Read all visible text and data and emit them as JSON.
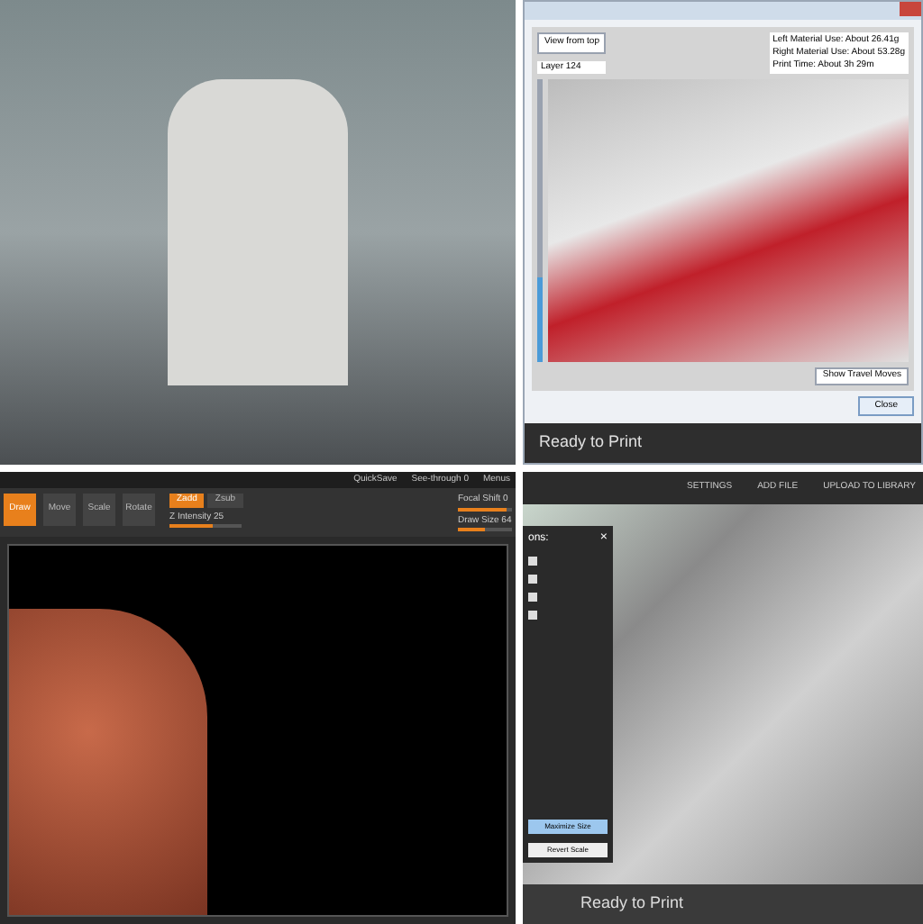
{
  "printer_preview": {
    "view_button": "View from top",
    "layer_label": "Layer 124",
    "layer_slider": {
      "level": 0.3
    },
    "info_lines": [
      "Left Material Use: About 26.41g",
      "Right Material Use: About 53.28g",
      "Print Time: About 3h 29m"
    ],
    "travel_button": "Show Travel Moves",
    "close_button": "Close",
    "status": "Ready to Print"
  },
  "sculpt_app": {
    "title_items": [
      "QuickSave",
      "See-through 0",
      "Menus"
    ],
    "tools": [
      {
        "label": "Draw",
        "selected": true
      },
      {
        "label": "Move",
        "selected": false
      },
      {
        "label": "Scale",
        "selected": false
      },
      {
        "label": "Rotate",
        "selected": false
      }
    ],
    "modes": [
      {
        "label": "Zadd",
        "selected": true
      },
      {
        "label": "Zsub",
        "selected": false
      }
    ],
    "settings": [
      {
        "label": "Focal Shift 0",
        "level": 0.9
      },
      {
        "label": "Draw Size 64",
        "level": 0.5
      }
    ],
    "intensity": {
      "label": "Z Intensity 25",
      "level": 0.6
    }
  },
  "print_app": {
    "nav": [
      "SETTINGS",
      "ADD FILE",
      "UPLOAD TO LIBRARY"
    ],
    "panel_title": "ons:",
    "panel_close": "×",
    "panel_options": [
      {
        "checked": false
      },
      {
        "checked": false
      },
      {
        "checked": false
      },
      {
        "checked": false
      }
    ],
    "buttons": [
      {
        "label": "Maximize Size",
        "selected": true
      },
      {
        "label": "Revert Scale",
        "selected": false
      }
    ],
    "status": "Ready to Print"
  }
}
